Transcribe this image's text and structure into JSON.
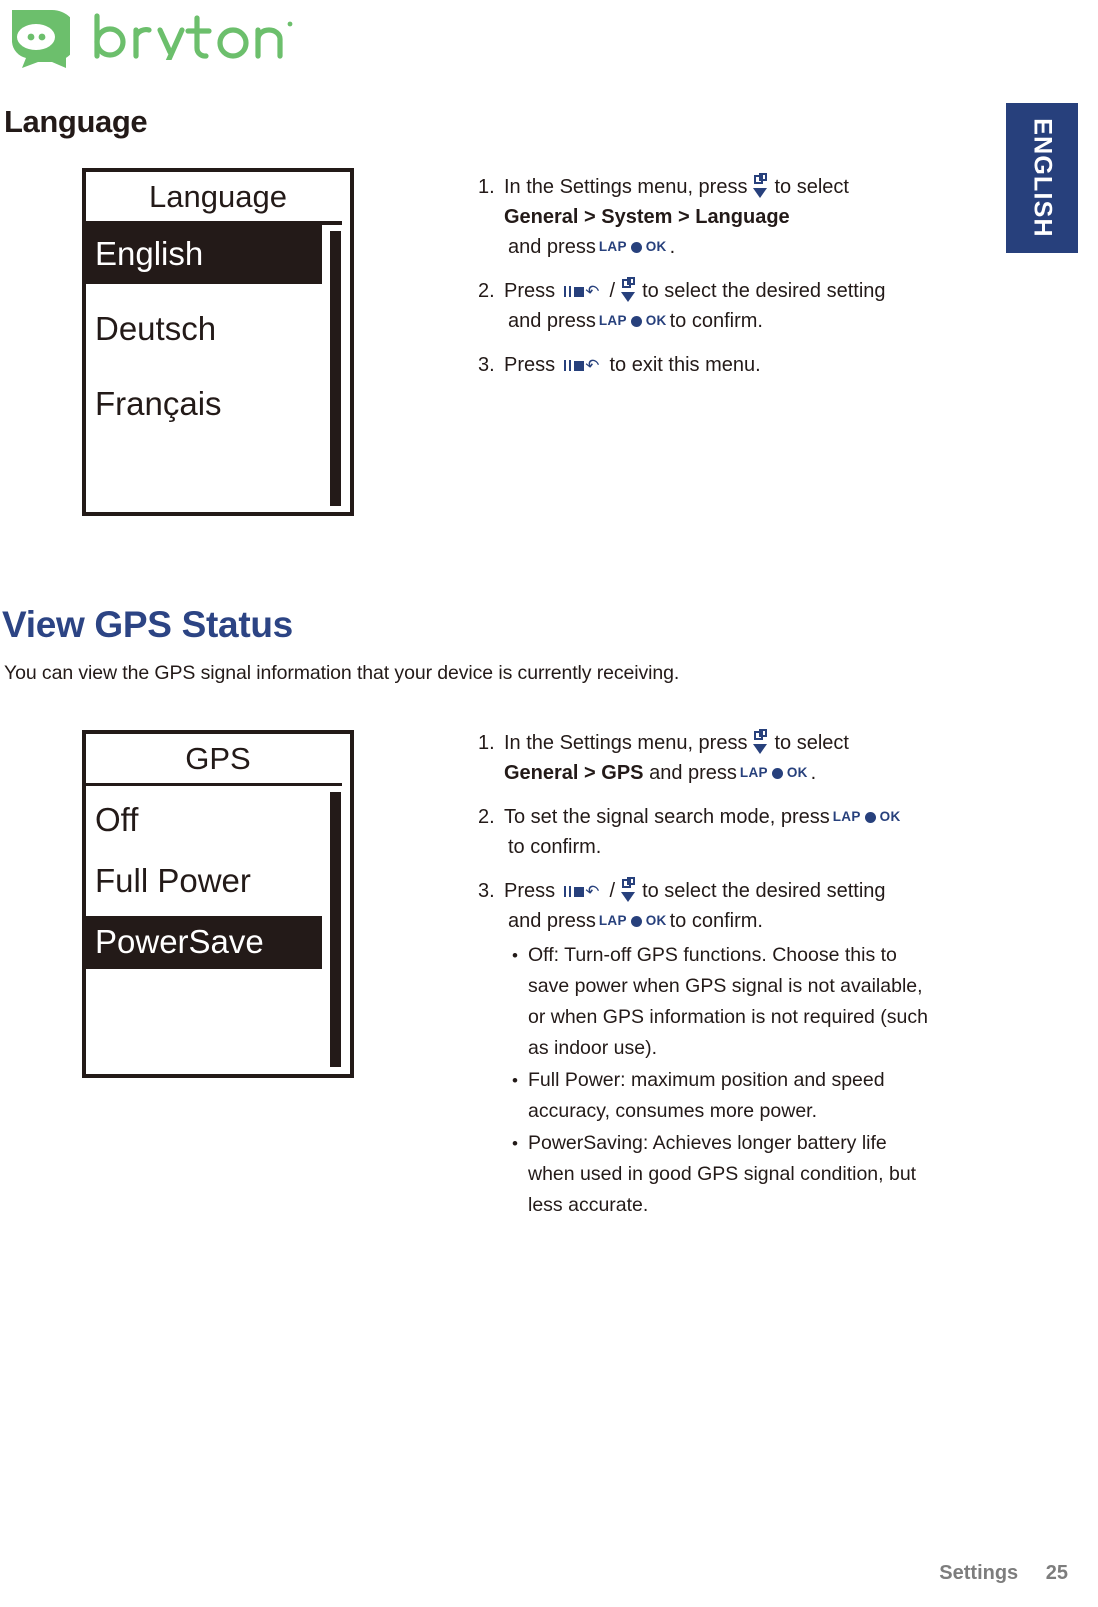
{
  "brand": {
    "logo_icon": "bryton-leaf-logo-icon",
    "wordmark": "bryton",
    "color": "#6cbf6c"
  },
  "language_tab": {
    "label": "ENGLISH",
    "background": "#27407c"
  },
  "sections": [
    {
      "id": "language",
      "heading": "Language",
      "heading_color": "#231a18",
      "device": {
        "screen_title": "Language",
        "rows": [
          {
            "label": "English",
            "selected": true
          },
          {
            "label": "Deutsch",
            "selected": false
          },
          {
            "label": "Français",
            "selected": false
          }
        ]
      },
      "steps": [
        {
          "num": "1.",
          "parts": [
            {
              "t": "text",
              "v": "In the Settings menu, press "
            },
            {
              "t": "icon",
              "v": "page-down-button-icon"
            },
            {
              "t": "text",
              "v": " to select"
            },
            {
              "t": "break"
            },
            {
              "t": "bold",
              "v": "General > System > Language"
            },
            {
              "t": "break"
            },
            {
              "t": "text",
              "v": "and press "
            },
            {
              "t": "icon",
              "v": "lap-ok-button-icon"
            },
            {
              "t": "text",
              "v": "."
            }
          ]
        },
        {
          "num": "2.",
          "parts": [
            {
              "t": "text",
              "v": "Press "
            },
            {
              "t": "icon",
              "v": "pause-stop-back-button-icon"
            },
            {
              "t": "text",
              "v": " / "
            },
            {
              "t": "icon",
              "v": "page-down-button-icon"
            },
            {
              "t": "text",
              "v": " to select the desired setting"
            },
            {
              "t": "break"
            },
            {
              "t": "text",
              "v": "and press "
            },
            {
              "t": "icon",
              "v": "lap-ok-button-icon"
            },
            {
              "t": "text",
              "v": " to confirm."
            }
          ]
        },
        {
          "num": "3.",
          "parts": [
            {
              "t": "text",
              "v": "Press "
            },
            {
              "t": "icon",
              "v": "pause-stop-back-button-icon"
            },
            {
              "t": "text",
              "v": " to exit this menu."
            }
          ]
        }
      ]
    },
    {
      "id": "gps",
      "heading": "View GPS Status",
      "heading_color": "#2c4484",
      "intro": "You can view the GPS signal information that your device is currently receiving.",
      "device": {
        "screen_title": "GPS",
        "rows": [
          {
            "label": "Off",
            "selected": false
          },
          {
            "label": "Full Power",
            "selected": false
          },
          {
            "label": "PowerSave",
            "selected": true
          }
        ]
      },
      "steps": [
        {
          "num": "1.",
          "parts": [
            {
              "t": "text",
              "v": "In the Settings menu, press "
            },
            {
              "t": "icon",
              "v": "page-down-button-icon"
            },
            {
              "t": "text",
              "v": " to select"
            },
            {
              "t": "break"
            },
            {
              "t": "bold",
              "v": "General > GPS"
            },
            {
              "t": "text",
              "v": " and press "
            },
            {
              "t": "icon",
              "v": "lap-ok-button-icon"
            },
            {
              "t": "text",
              "v": "."
            }
          ]
        },
        {
          "num": "2.",
          "parts": [
            {
              "t": "text",
              "v": "To set the signal search mode, press "
            },
            {
              "t": "icon",
              "v": "lap-ok-button-icon"
            },
            {
              "t": "break"
            },
            {
              "t": "text",
              "v": "to confirm."
            }
          ]
        },
        {
          "num": "3.",
          "parts": [
            {
              "t": "text",
              "v": "Press "
            },
            {
              "t": "icon",
              "v": "pause-stop-back-button-icon"
            },
            {
              "t": "text",
              "v": " / "
            },
            {
              "t": "icon",
              "v": "page-down-button-icon"
            },
            {
              "t": "text",
              "v": " to select the desired setting"
            },
            {
              "t": "break"
            },
            {
              "t": "text",
              "v": "and press "
            },
            {
              "t": "icon",
              "v": "lap-ok-button-icon"
            },
            {
              "t": "text",
              "v": " to confirm."
            }
          ]
        }
      ],
      "bullets": [
        "Off: Turn-off GPS functions. Choose this to save power when GPS signal is not available, or when GPS information is not required (such as indoor use).",
        "Full Power: maximum position and speed accuracy, consumes more power.",
        "PowerSaving: Achieves longer battery life when used in good GPS signal condition, but less accurate."
      ]
    }
  ],
  "buttons": {
    "lap_left_label": "LAP",
    "lap_right_label": "OK"
  },
  "footer": {
    "chapter": "Settings",
    "page": "25",
    "color": "#7d7d7d"
  }
}
